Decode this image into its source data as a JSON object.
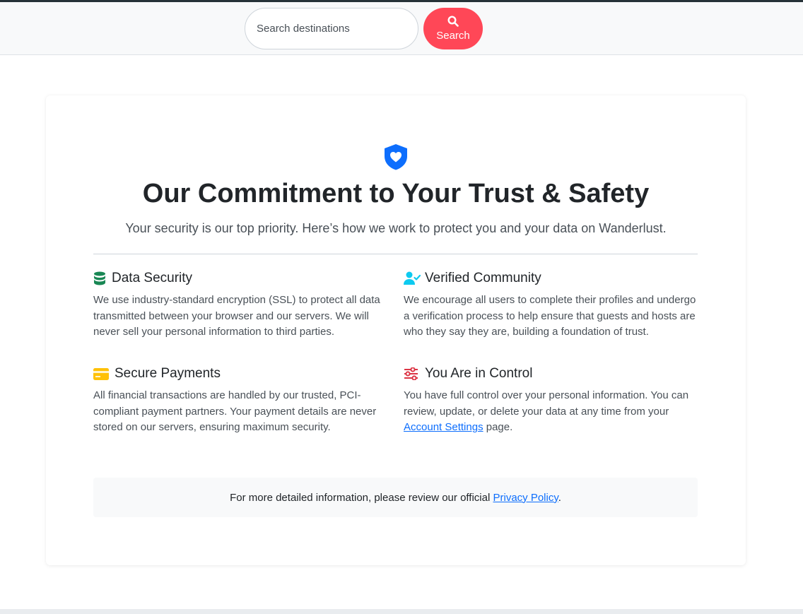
{
  "header": {
    "search_placeholder": "Search destinations",
    "search_button_label": "Search",
    "search_icon": "magnifier-icon",
    "accent_color": "#ff4757"
  },
  "page": {
    "hero_icon": "shield-heart-icon",
    "title": "Our Commitment to Your Trust & Safety",
    "subtitle": "Your security is our top priority. Here’s how we work to protect you and your data on Wanderlust."
  },
  "features": [
    {
      "icon": "database-icon",
      "icon_color": "#198754",
      "title": "Data Security",
      "text": "We use industry-standard encryption (SSL) to protect all data transmitted between your browser and our servers. We will never sell your personal information to third parties."
    },
    {
      "icon": "user-check-icon",
      "icon_color": "#0dcaf0",
      "title": "Verified Community",
      "text": "We encourage all users to complete their profiles and undergo a verification process to help ensure that guests and hosts are who they say they are, building a foundation of trust."
    },
    {
      "icon": "credit-card-icon",
      "icon_color": "#ffc107",
      "title": "Secure Payments",
      "text": "All financial transactions are handled by our trusted, PCI-compliant payment partners. Your payment details are never stored on our servers, ensuring maximum security."
    },
    {
      "icon": "sliders-icon",
      "icon_color": "#dc3545",
      "title": "You Are in Control",
      "text_before_link": "You have full control over your personal information. You can review, update, or delete your data at any time from your ",
      "link_label": "Account Settings",
      "text_after_link": " page."
    }
  ],
  "policy": {
    "text_before_link": "For more detailed information, please review our official ",
    "link_label": "Privacy Policy",
    "text_after_link": "."
  }
}
